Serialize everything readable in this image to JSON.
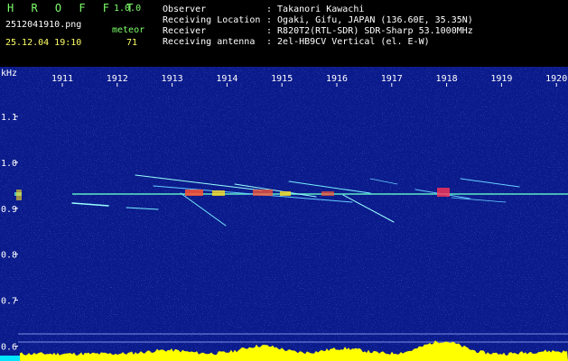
{
  "header": {
    "app_name": "H R O F F T",
    "version": "1.0.0",
    "filename": "2512041910.png",
    "mode": "meteor",
    "datetime": "25.12.04 19:10",
    "count": "71",
    "info_labels": [
      "Observer",
      "Receiving Location",
      "Receiver",
      "Receiving antenna"
    ],
    "info_values": [
      ": Takanori Kawachi",
      ": Ogaki, Gifu, JAPAN (136.60E, 35.35N)",
      ": R820T2(RTL-SDR) SDR-Sharp 53.1000MHz",
      ": 2el-HB9CV Vertical (el. E-W)"
    ]
  },
  "axes": {
    "y_unit": "kHz",
    "y_ticks": [
      "1.1",
      "1.0",
      "0.9",
      "0.8",
      "0.7",
      "0.6"
    ],
    "y_values": [
      1.1,
      1.0,
      0.9,
      0.8,
      0.7,
      0.6
    ],
    "x_ticks": [
      "1911",
      "1912",
      "1913",
      "1914",
      "1915",
      "1916",
      "1917",
      "1918",
      "1919",
      "1920"
    ]
  },
  "colors": {
    "background_blue": "#0a1a8a",
    "carrier": "#66ffcc",
    "text_white": "#ffffff",
    "text_green": "#7dff6a",
    "text_yellow": "#ffff66",
    "power_trace": "#ffff00"
  }
}
